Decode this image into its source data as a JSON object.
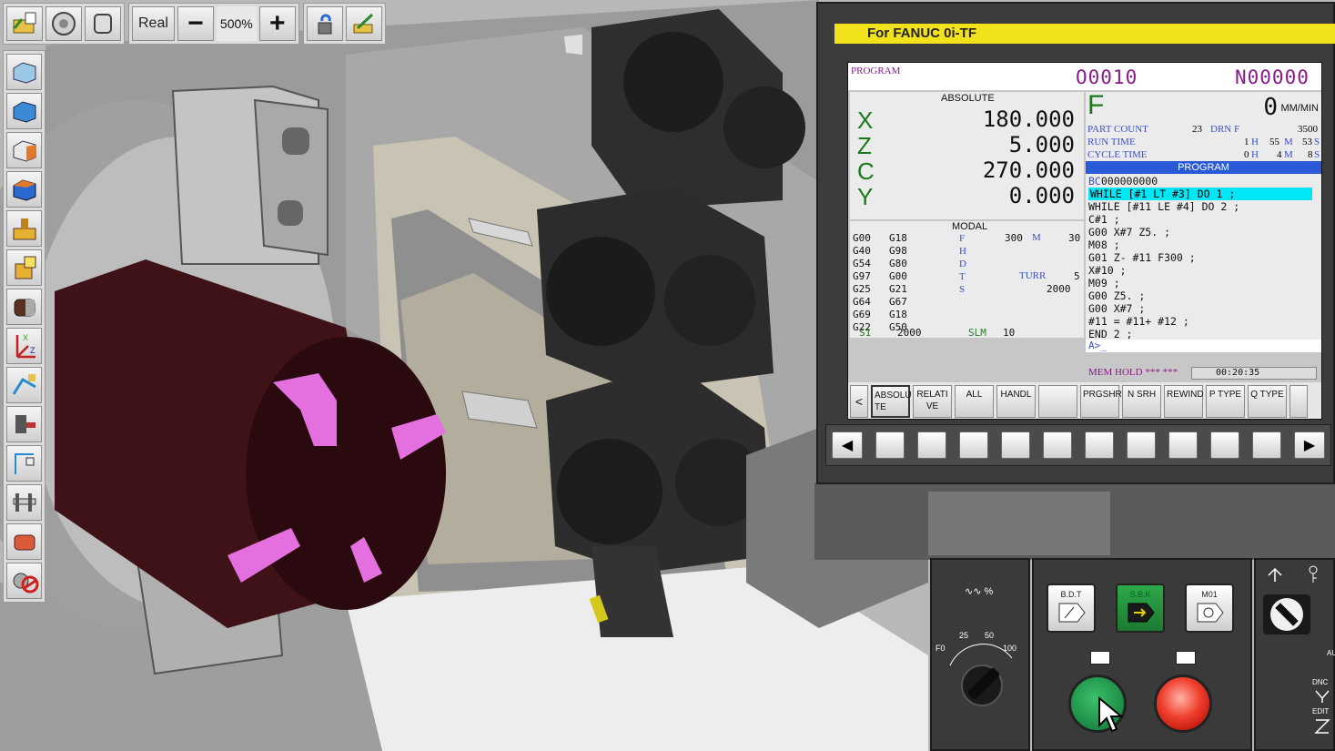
{
  "toolbar": {
    "zoom_mode": "Real",
    "zoom_minus": "−",
    "zoom_value": "500%",
    "zoom_plus": "+"
  },
  "fanuc": {
    "title": "For FANUC 0i-TF",
    "program_label": "PROGRAM",
    "o_number": "O0010",
    "n_number": "N00000",
    "absolute_label": "ABSOLUTE",
    "axes": [
      {
        "name": "X",
        "value": "180.000"
      },
      {
        "name": "Z",
        "value": "5.000"
      },
      {
        "name": "C",
        "value": "270.000"
      },
      {
        "name": "Y",
        "value": "0.000"
      }
    ],
    "feed_letter": "F",
    "feed_value": "0",
    "feed_unit": "MM/MIN",
    "part_count_label": "PART COUNT",
    "part_count_value": "23",
    "drn_label": "DRN F",
    "drn_value": "3500",
    "run_time_label": "RUN TIME",
    "run_time_h": "1",
    "run_time_m": "55",
    "run_time_s": "53",
    "cycle_time_label": "CYCLE TIME",
    "cycle_time_h": "0",
    "cycle_time_m": "4",
    "cycle_time_s": "8",
    "unit_h": "H",
    "unit_m": "M",
    "unit_s": "S",
    "program_title": "PROGRAM",
    "program_prefix": "BC",
    "program_prefix_value": "000000000",
    "program_lines": [
      "WHILE [#1 LT #3] DO 1 ;",
      "WHILE [#11 LE #4] DO 2 ;",
      "C#1 ;",
      "G00 X#7 Z5. ;",
      "M08 ;",
      "G01 Z- #11 F300 ;",
      "X#10 ;",
      "M09 ;",
      "G00 Z5. ;",
      "G00 X#7 ;",
      "#11 = #11+ #12 ;",
      "END 2 ;"
    ],
    "modal_label": "MODAL",
    "gcodes": [
      "G00",
      "G18",
      "G40",
      "G98",
      "G54",
      "G80",
      "G97",
      "G00",
      "G25",
      "G21",
      "G64",
      "G67",
      "G69",
      "G18",
      "G22",
      "G50"
    ],
    "modal_letters": [
      "F",
      "H",
      "D",
      "T",
      "S"
    ],
    "modal_f_value": "300",
    "modal_m_label": "M",
    "modal_m_value": "30",
    "modal_turr_label": "TURR",
    "modal_turr_value": "5",
    "modal_s_value": "2000",
    "s1_label": "S1",
    "s1_value": "2000",
    "slm_label": "SLM",
    "slm_value": "10",
    "input_prompt": "A>_",
    "status_mode": "MEM HOLD",
    "status_stars": "*** ***",
    "status_time": "00:20:35",
    "softkeys": [
      "<",
      "ABSOLU TE",
      "RELATI VE",
      "ALL",
      "HANDL",
      "",
      "PRGSHR",
      "N SRH",
      "REWIND",
      "P TYPE",
      "Q TYPE",
      ""
    ],
    "fkey_left": "◀",
    "fkey_right": "▶"
  },
  "control": {
    "feed_symbol": "∿∿ %",
    "dial_labels": [
      "F0",
      "25",
      "50",
      "100"
    ],
    "bdt_label": "B.D.T",
    "sbk_label": "S.B.K",
    "m01_label": "M01",
    "key_labels": [
      "AU",
      "DNC",
      "EDIT"
    ]
  }
}
